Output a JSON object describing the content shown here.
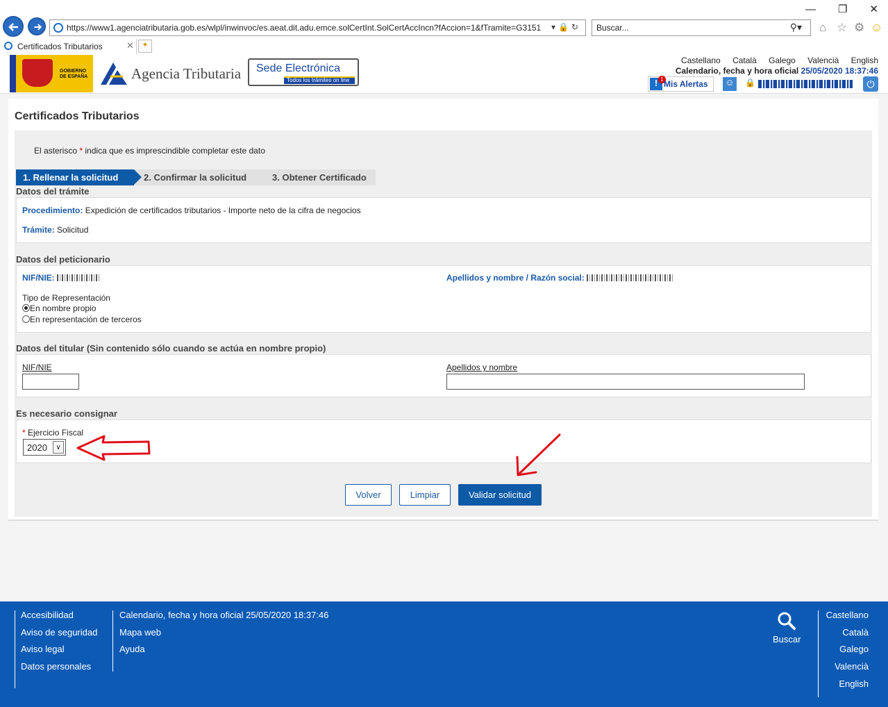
{
  "browser": {
    "url": "https://www1.agenciatributaria.gob.es/wlpl/inwinvoc/es.aeat.dit.adu.emce.solCertInt.SolCertAccIncn?fAccion=1&fTramite=G3151",
    "search_placeholder": "Buscar...",
    "tab_title": "Certificados Tributarios"
  },
  "header": {
    "gobierno": "GOBIERNO DE ESPAÑA",
    "agency": "Agencia Tributaria",
    "sede_title": "Sede Electrónica",
    "sede_subtitle": "Todos los trámites on line",
    "languages": [
      "Castellano",
      "Català",
      "Galego",
      "Valencià",
      "English"
    ],
    "calendar_label": "Calendario, fecha y hora oficial",
    "calendar_datetime": "25/05/2020 18:37:46",
    "alerts_label": "Mis Alertas",
    "alerts_count": "1"
  },
  "page": {
    "title": "Certificados Tributarios",
    "asterisk_note_pre": "El asterisco",
    "asterisk_symbol": "*",
    "asterisk_note_post": "indica que es imprescindible completar este dato",
    "steps": [
      "1. Rellenar la solicitud",
      "2. Confirmar la solicitud",
      "3. Obtener Certificado"
    ]
  },
  "tramite": {
    "section_title": "Datos del trámite",
    "procedimiento_label": "Procedimiento:",
    "procedimiento_value": "Expedición de certificados tributarios - Importe neto de la cifra de negocios",
    "tramite_label": "Trámite:",
    "tramite_value": "Solicitud"
  },
  "peticionario": {
    "section_title": "Datos del peticionario",
    "nif_label": "NIF/NIE:",
    "nombre_label": "Apellidos y nombre / Razón social:",
    "representacion_label": "Tipo de Representación",
    "options": [
      {
        "label": "En nombre propio",
        "selected": true
      },
      {
        "label": "En representación de terceros",
        "selected": false
      }
    ]
  },
  "titular": {
    "section_title": "Datos del titular (Sin contenido sólo cuando se actúa en nombre propio)",
    "nif_label": "NIF/NIE",
    "nif_value": "",
    "nombre_label": "Apellidos y nombre",
    "nombre_value": ""
  },
  "consignar": {
    "section_title": "Es necesario consignar",
    "required_mark": "*",
    "ejercicio_label": "Ejercicio Fiscal",
    "ejercicio_value": "2020"
  },
  "buttons": {
    "volver": "Volver",
    "limpiar": "Limpiar",
    "validar": "Validar solicitud"
  },
  "footer": {
    "col1": [
      "Accesibilidad",
      "Aviso de seguridad",
      "Aviso legal",
      "Datos personales"
    ],
    "col2": [
      "Calendario, fecha y hora oficial 25/05/2020 18:37:46",
      "Mapa web",
      "Ayuda"
    ],
    "search_label": "Buscar",
    "languages": [
      "Castellano",
      "Català",
      "Galego",
      "Valencià",
      "English"
    ]
  },
  "colors": {
    "brand_blue": "#0d5aa7",
    "footer_blue": "#0d5ab5",
    "annotation_red": "#e0101a"
  }
}
